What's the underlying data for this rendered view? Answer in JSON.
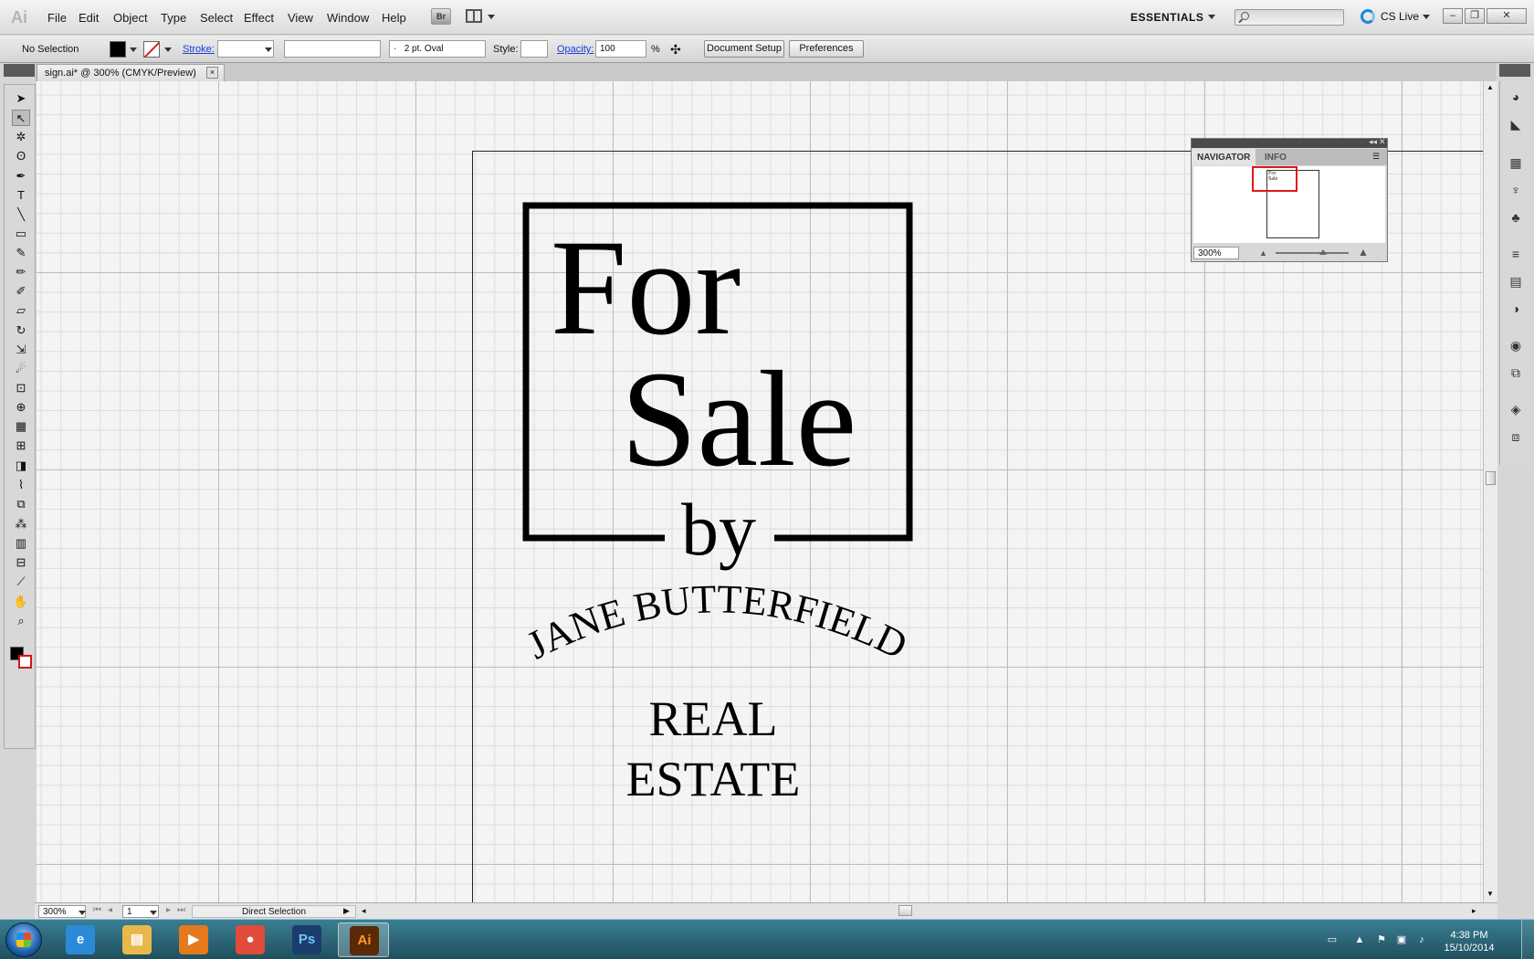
{
  "app": {
    "logo_text": "Ai"
  },
  "menu": [
    "File",
    "Edit",
    "Object",
    "Type",
    "Select",
    "Effect",
    "View",
    "Window",
    "Help"
  ],
  "menubar": {
    "bridge_label": "Br",
    "workspace": "ESSENTIALS",
    "search_placeholder": "",
    "cs_live": "CS Live"
  },
  "control_bar": {
    "selection": "No Selection",
    "stroke_label": "Stroke:",
    "brush": "2 pt. Oval",
    "brush_dot": "·",
    "style_label": "Style:",
    "opacity_label": "Opacity:",
    "opacity_value": "100",
    "percent": "%",
    "document_setup": "Document Setup",
    "preferences": "Preferences"
  },
  "document_tab": {
    "title": "sign.ai* @ 300% (CMYK/Preview)",
    "close": "×"
  },
  "tools": [
    {
      "name": "selection-tool",
      "glyph": "➤"
    },
    {
      "name": "direct-selection-tool",
      "glyph": "↖",
      "selected": true
    },
    {
      "name": "magic-wand-tool",
      "glyph": "✲"
    },
    {
      "name": "lasso-tool",
      "glyph": "ʘ"
    },
    {
      "name": "pen-tool",
      "glyph": "✒"
    },
    {
      "name": "type-tool",
      "glyph": "T"
    },
    {
      "name": "line-tool",
      "glyph": "╲"
    },
    {
      "name": "rectangle-tool",
      "glyph": "▭"
    },
    {
      "name": "paintbrush-tool",
      "glyph": "✎"
    },
    {
      "name": "pencil-tool",
      "glyph": "✏"
    },
    {
      "name": "blob-brush-tool",
      "glyph": "✐"
    },
    {
      "name": "eraser-tool",
      "glyph": "▱"
    },
    {
      "name": "rotate-tool",
      "glyph": "↻"
    },
    {
      "name": "scale-tool",
      "glyph": "⇲"
    },
    {
      "name": "warp-tool",
      "glyph": "☄"
    },
    {
      "name": "free-transform-tool",
      "glyph": "⊡"
    },
    {
      "name": "shape-builder-tool",
      "glyph": "⊕"
    },
    {
      "name": "perspective-grid-tool",
      "glyph": "▦"
    },
    {
      "name": "mesh-tool",
      "glyph": "⊞"
    },
    {
      "name": "gradient-tool",
      "glyph": "◨"
    },
    {
      "name": "eyedropper-tool",
      "glyph": "⌇"
    },
    {
      "name": "blend-tool",
      "glyph": "⧉"
    },
    {
      "name": "symbol-sprayer-tool",
      "glyph": "⁂"
    },
    {
      "name": "column-graph-tool",
      "glyph": "▥"
    },
    {
      "name": "artboard-tool",
      "glyph": "⊟"
    },
    {
      "name": "slice-tool",
      "glyph": "⟋"
    },
    {
      "name": "hand-tool",
      "glyph": "✋"
    },
    {
      "name": "zoom-tool",
      "glyph": "⌕"
    }
  ],
  "artwork": {
    "line1": "For",
    "line2": "Sale",
    "line3": "by",
    "arc_text": "JANE BUTTERFIELD",
    "line4": "REAL",
    "line5": "ESTATE"
  },
  "navigator": {
    "tab1": "NAVIGATOR",
    "tab2": "INFO",
    "zoom": "300%",
    "thumb_text": "For Sale"
  },
  "status_bar": {
    "zoom": "300%",
    "page": "1",
    "tool": "Direct Selection"
  },
  "taskbar": {
    "apps": [
      {
        "name": "internet-explorer",
        "label": "e",
        "color": "#2a8ad8"
      },
      {
        "name": "file-explorer",
        "label": "▤",
        "color": "#e8b84a"
      },
      {
        "name": "media-player",
        "label": "▶",
        "color": "#e57a1c"
      },
      {
        "name": "chrome",
        "label": "●",
        "color": "#e24a3a"
      },
      {
        "name": "photoshop",
        "label": "Ps",
        "color": "#1b3d6e"
      },
      {
        "name": "illustrator",
        "label": "Ai",
        "color": "#5a2a06",
        "active": true
      }
    ],
    "time": "4:38 PM",
    "date": "15/10/2014"
  }
}
